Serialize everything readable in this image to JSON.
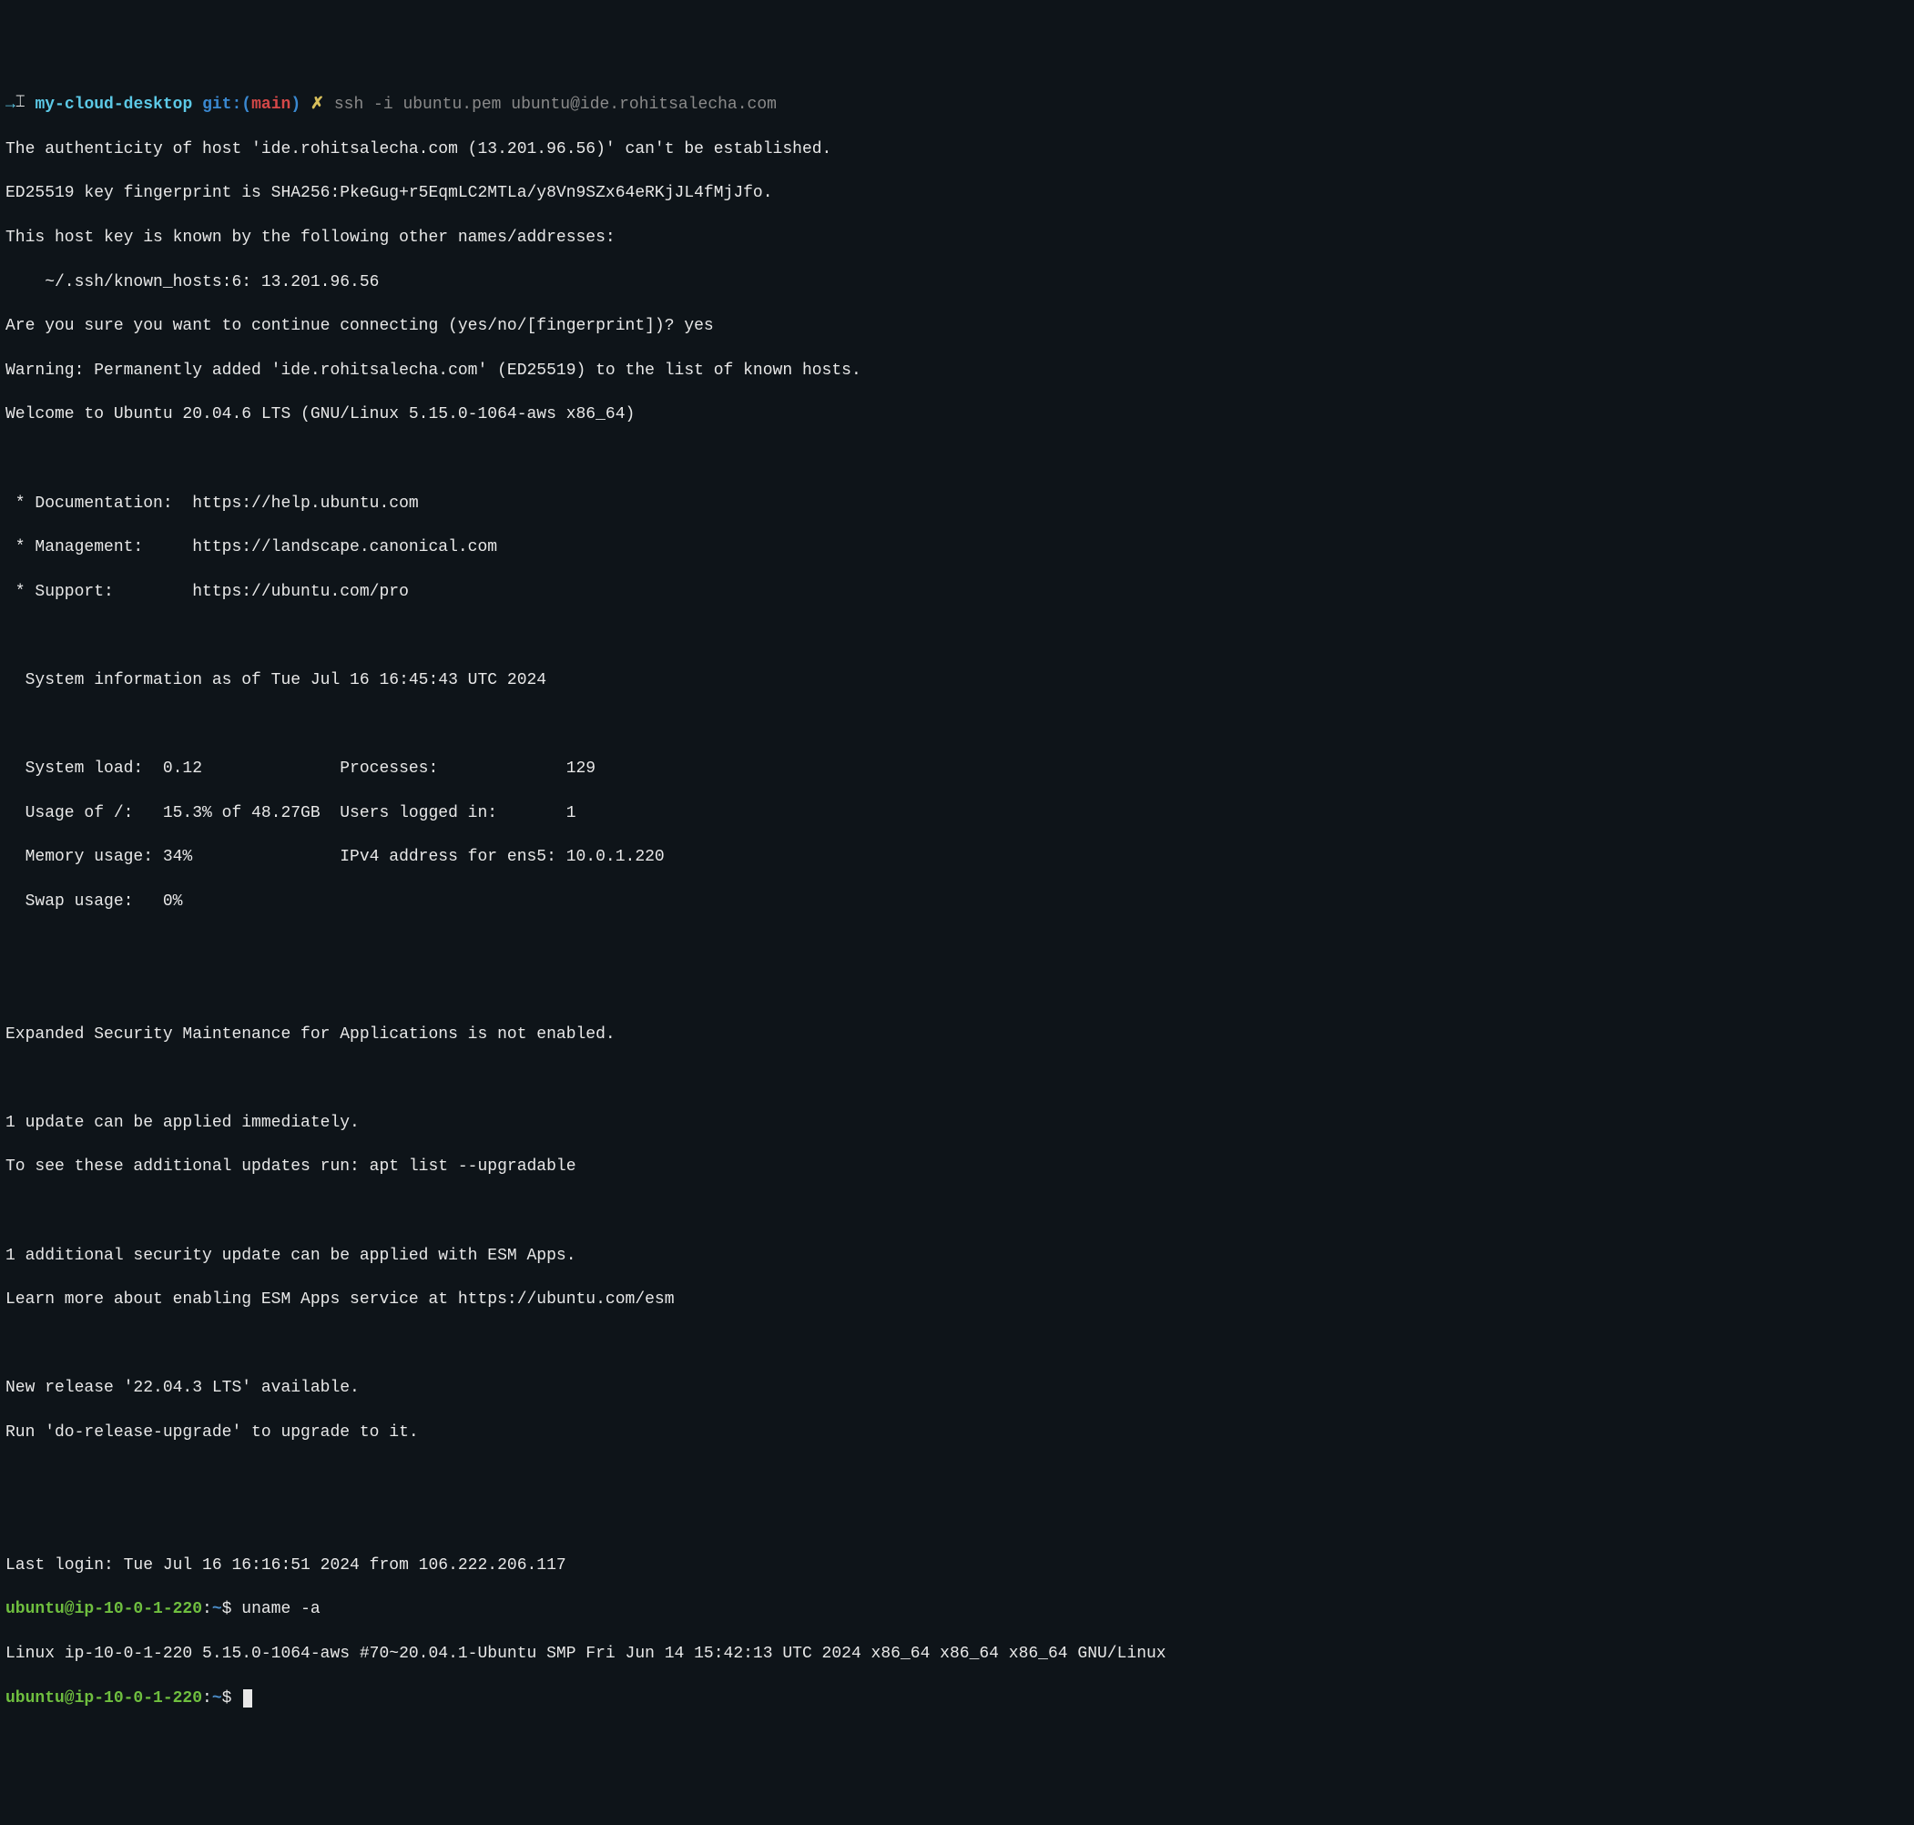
{
  "prompt1": {
    "arrow": "→",
    "ibeam": "⌶",
    "dir": "my-cloud-desktop",
    "git_label": "git:(",
    "git_branch": "main",
    "git_close": ")",
    "x": "✗",
    "cmd_ssh": "ssh -i ubuntu.pem ",
    "cmd_target": "ubuntu@ide.rohitsalecha.com"
  },
  "auth": {
    "l1": "The authenticity of host 'ide.rohitsalecha.com (13.201.96.56)' can't be established.",
    "l2": "ED25519 key fingerprint is SHA256:PkeGug+r5EqmLC2MTLa/y8Vn9SZx64eRKjJL4fMjJfo.",
    "l3": "This host key is known by the following other names/addresses:",
    "l4": "    ~/.ssh/known_hosts:6: 13.201.96.56",
    "l5": "Are you sure you want to continue connecting (yes/no/[fingerprint])? yes",
    "l6": "Warning: Permanently added 'ide.rohitsalecha.com' (ED25519) to the list of known hosts.",
    "l7": "Welcome to Ubuntu 20.04.6 LTS (GNU/Linux 5.15.0-1064-aws x86_64)"
  },
  "links": {
    "doc": " * Documentation:  https://help.ubuntu.com",
    "mgmt": " * Management:     https://landscape.canonical.com",
    "supp": " * Support:        https://ubuntu.com/pro"
  },
  "sysinfo": {
    "header": "  System information as of Tue Jul 16 16:45:43 UTC 2024",
    "r1": "  System load:  0.12              Processes:             129",
    "r2": "  Usage of /:   15.3% of 48.27GB  Users logged in:       1",
    "r3": "  Memory usage: 34%               IPv4 address for ens5: 10.0.1.220",
    "r4": "  Swap usage:   0%"
  },
  "esm": {
    "l1": "Expanded Security Maintenance for Applications is not enabled.",
    "l2": "1 update can be applied immediately.",
    "l3": "To see these additional updates run: apt list --upgradable",
    "l4": "1 additional security update can be applied with ESM Apps.",
    "l5": "Learn more about enabling ESM Apps service at https://ubuntu.com/esm"
  },
  "release": {
    "l1": "New release '22.04.3 LTS' available.",
    "l2": "Run 'do-release-upgrade' to upgrade to it."
  },
  "lastlogin": "Last login: Tue Jul 16 16:16:51 2024 from 106.222.206.117",
  "remote": {
    "userhost": "ubuntu@ip-10-0-1-220",
    "colon": ":",
    "tilde": "~",
    "dollar": "$ ",
    "cmd1": "uname -a",
    "uname_out": "Linux ip-10-0-1-220 5.15.0-1064-aws #70~20.04.1-Ubuntu SMP Fri Jun 14 15:42:13 UTC 2024 x86_64 x86_64 x86_64 GNU/Linux"
  }
}
